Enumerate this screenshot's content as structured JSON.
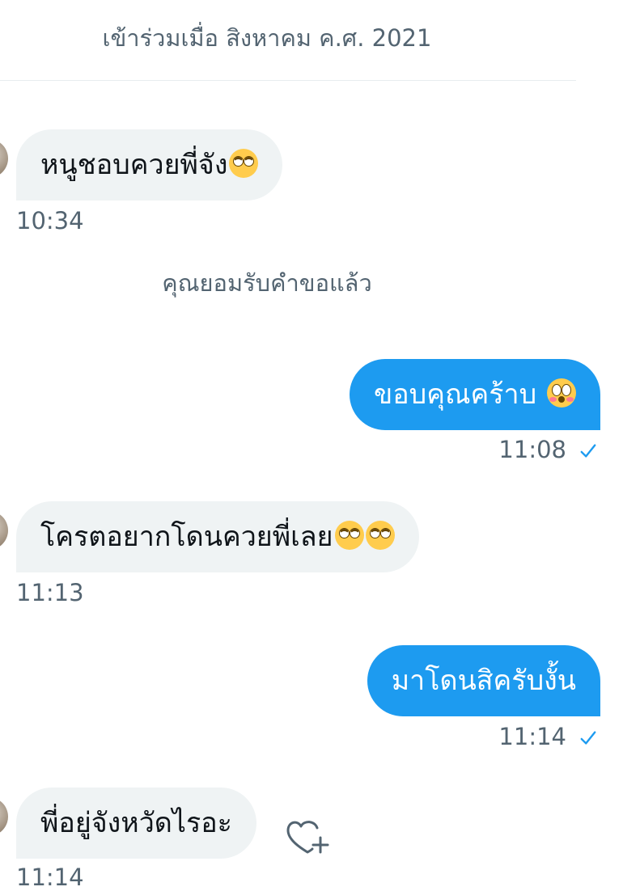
{
  "header": {
    "joined_text": "เข้าร่วมเมื่อ สิงหาคม ค.ศ. 2021"
  },
  "messages": [
    {
      "direction": "in",
      "text": "หนูชอบควยพี่จัง",
      "emoji": [
        "face-with-rolling-eyes"
      ],
      "time": "10:34"
    },
    {
      "direction": "system",
      "text": "คุณยอมรับคำขอแล้ว"
    },
    {
      "direction": "out",
      "text": "ขอบคุณคร้าบ ",
      "emoji": [
        "flushed-face"
      ],
      "time": "11:08",
      "status": "sent"
    },
    {
      "direction": "in",
      "text": "โครตอยากโดนควยพี่เลย",
      "emoji": [
        "face-with-rolling-eyes",
        "face-with-rolling-eyes"
      ],
      "time": "11:13"
    },
    {
      "direction": "out",
      "text": "มาโดนสิครับงั้น",
      "emoji": [],
      "time": "11:14",
      "status": "sent"
    },
    {
      "direction": "in",
      "text": "พี่อยู่จังหวัดไรอะ",
      "emoji": [],
      "time": "11:14"
    }
  ],
  "icons": {
    "sent": "check-icon",
    "react": "add-reaction-heart-icon"
  },
  "colors": {
    "outgoing_bubble": "#1d9bf0",
    "incoming_bubble": "#eff3f4",
    "muted_text": "#536471",
    "check": "#1d9bf0"
  }
}
